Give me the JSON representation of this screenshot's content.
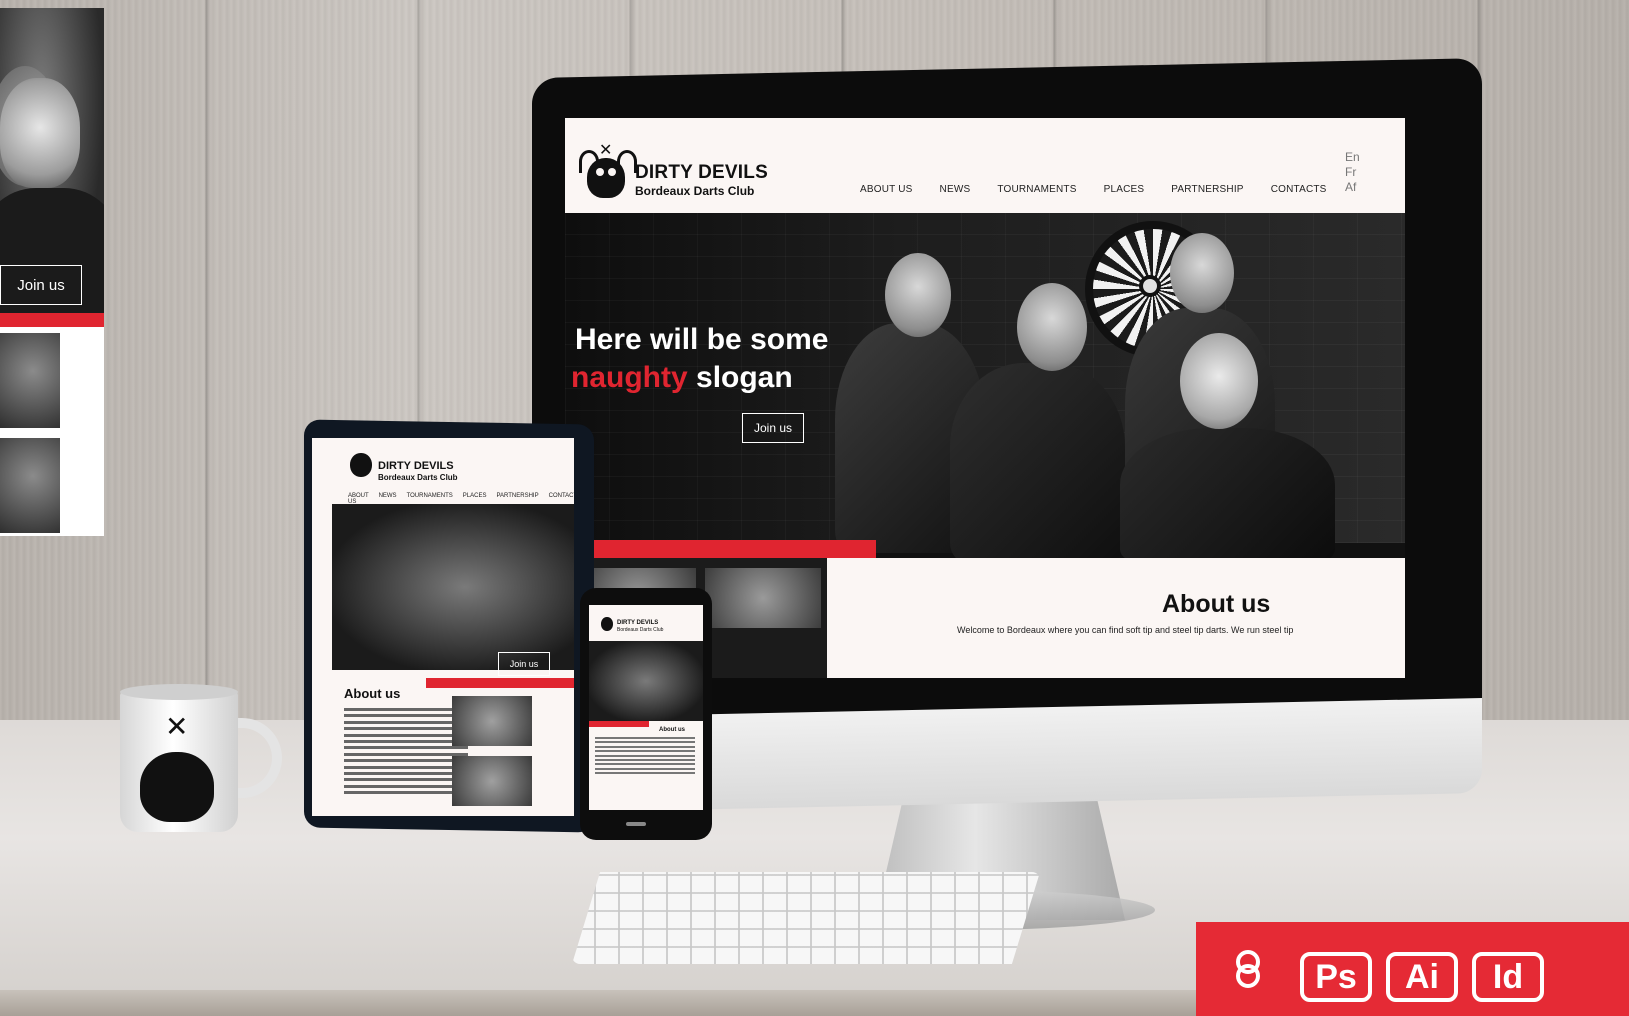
{
  "left_panel": {
    "join_label": "Join us"
  },
  "desktop_site": {
    "brand_title": "DIRTY DEVILS",
    "brand_subtitle": "Bordeaux Darts Club",
    "nav": [
      "ABOUT US",
      "NEWS",
      "TOURNAMENTS",
      "PLACES",
      "PARTNERSHIP",
      "CONTACTS"
    ],
    "languages": [
      "En",
      "Fr",
      "Af"
    ],
    "hero_line1": "Here will be some",
    "hero_accent": "naughty",
    "hero_rest": " slogan",
    "join_label": "Join us",
    "about_title": "About us",
    "about_text": "Welcome to Bordeaux where you can find soft tip and steel tip darts. We run steel tip"
  },
  "tablet_site": {
    "brand_title": "DIRTY DEVILS",
    "brand_subtitle": "Bordeaux Darts Club",
    "nav": [
      "ABOUT US",
      "NEWS",
      "TOURNAMENTS",
      "PLACES",
      "PARTNERSHIP",
      "CONTACTS"
    ],
    "join_label": "Join us",
    "about_title": "About us"
  },
  "phone_site": {
    "brand_title": "DIRTY DEVILS",
    "brand_subtitle": "Bordeaux Darts Club",
    "about_title": "About us"
  },
  "badge": {
    "icons": [
      "Ps",
      "Ai",
      "Id"
    ]
  },
  "colors": {
    "accent_red": "#e02530",
    "header_bg": "#fbf6f4",
    "dark": "#111111"
  }
}
